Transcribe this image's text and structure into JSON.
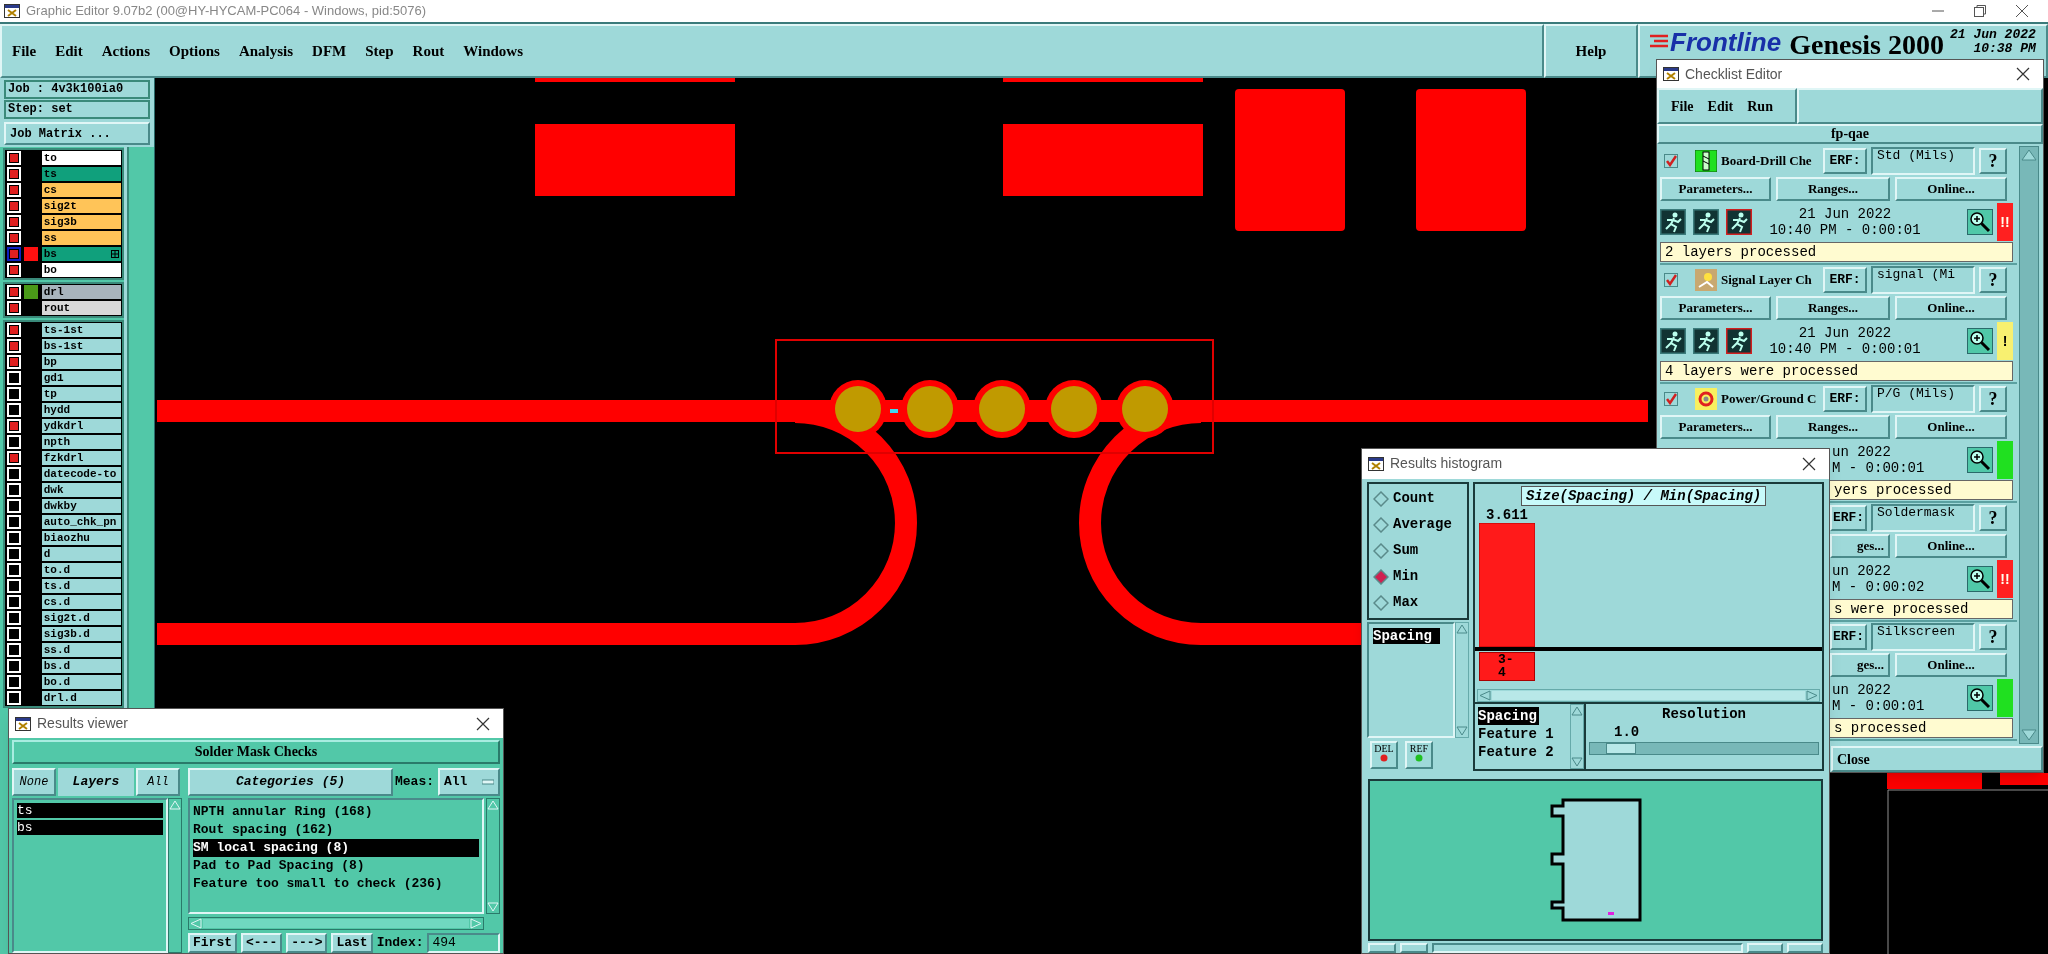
{
  "window": {
    "title": "Graphic Editor 9.07b2 (00@HY-HYCAM-PC064 - Windows, pid:5076)"
  },
  "menu": [
    "File",
    "Edit",
    "Actions",
    "Options",
    "Analysis",
    "DFM",
    "Step",
    "Rout",
    "Windows"
  ],
  "help": "Help",
  "brand": {
    "logo": "Frontline",
    "product": "Genesis 2000",
    "date": "21 Jun 2022",
    "time": "10:38 PM"
  },
  "job_panel": {
    "job": "Job : 4v3k100ia0",
    "step": "Step: set",
    "matrix_button": "Job Matrix ...",
    "layer_groups": [
      [
        {
          "name": "to",
          "checked": true,
          "selected": false,
          "color": "#ffffff"
        },
        {
          "name": "ts",
          "checked": true,
          "selected": false,
          "color": "#10a07c"
        },
        {
          "name": "cs",
          "checked": true,
          "selected": false,
          "color": "#ffc458"
        },
        {
          "name": "sig2t",
          "checked": true,
          "selected": false,
          "color": "#ffc458"
        },
        {
          "name": "sig3b",
          "checked": true,
          "selected": false,
          "color": "#ffc458"
        },
        {
          "name": "ss",
          "checked": true,
          "selected": false,
          "color": "#ffc458"
        },
        {
          "name": "bs",
          "checked": true,
          "selected": true,
          "color": "#10a07c",
          "swatch": {
            "color": "#ff1010"
          }
        },
        {
          "name": "bo",
          "checked": true,
          "selected": false,
          "color": "#ffffff"
        }
      ],
      [
        {
          "name": "drl",
          "checked": true,
          "selected": false,
          "color": "#a8b4bc",
          "swatch": {
            "color": "#4a9a18"
          }
        },
        {
          "name": "rout",
          "checked": true,
          "selected": false,
          "color": "#d8d8d8"
        }
      ],
      [
        {
          "name": "ts-1st",
          "checked": true,
          "selected": false,
          "color": "#9ed9d9"
        },
        {
          "name": "bs-1st",
          "checked": true,
          "selected": false,
          "color": "#9ed9d9"
        },
        {
          "name": "bp",
          "checked": true,
          "selected": false,
          "color": "#9ed9d9"
        },
        {
          "name": "gd1",
          "checked": false,
          "selected": false,
          "color": "#9ed9d9"
        },
        {
          "name": "tp",
          "checked": false,
          "selected": false,
          "color": "#9ed9d9"
        },
        {
          "name": "hydd",
          "checked": false,
          "selected": false,
          "color": "#9ed9d9"
        },
        {
          "name": "ydkdrl",
          "checked": true,
          "selected": false,
          "color": "#9ed9d9"
        },
        {
          "name": "npth",
          "checked": false,
          "selected": false,
          "color": "#9ed9d9"
        },
        {
          "name": "fzkdrl",
          "checked": true,
          "selected": false,
          "color": "#9ed9d9"
        },
        {
          "name": "datecode-to",
          "checked": false,
          "selected": false,
          "color": "#9ed9d9"
        },
        {
          "name": "dwk",
          "checked": false,
          "selected": false,
          "color": "#9ed9d9"
        },
        {
          "name": "dwkby",
          "checked": false,
          "selected": false,
          "color": "#9ed9d9"
        },
        {
          "name": "auto_chk_pn",
          "checked": false,
          "selected": false,
          "color": "#9ed9d9"
        },
        {
          "name": "biaozhu",
          "checked": false,
          "selected": false,
          "color": "#9ed9d9"
        },
        {
          "name": "d",
          "checked": false,
          "selected": false,
          "color": "#9ed9d9"
        },
        {
          "name": "to.d",
          "checked": false,
          "selected": false,
          "color": "#9ed9d9"
        },
        {
          "name": "ts.d",
          "checked": false,
          "selected": false,
          "color": "#9ed9d9"
        },
        {
          "name": "cs.d",
          "checked": false,
          "selected": false,
          "color": "#9ed9d9"
        },
        {
          "name": "sig2t.d",
          "checked": false,
          "selected": false,
          "color": "#9ed9d9"
        },
        {
          "name": "sig3b.d",
          "checked": false,
          "selected": false,
          "color": "#9ed9d9"
        },
        {
          "name": "ss.d",
          "checked": false,
          "selected": false,
          "color": "#9ed9d9"
        },
        {
          "name": "bs.d",
          "checked": false,
          "selected": false,
          "color": "#9ed9d9"
        },
        {
          "name": "bo.d",
          "checked": false,
          "selected": false,
          "color": "#9ed9d9"
        },
        {
          "name": "drl.d",
          "checked": false,
          "selected": false,
          "color": "#9ed9d9"
        }
      ]
    ]
  },
  "checklist": {
    "title": "Checklist Editor",
    "menu": [
      "File",
      "Edit",
      "Run"
    ],
    "name": "fp-qae",
    "close": "Close",
    "entries": [
      {
        "covered_top": false,
        "covered_bottom": false,
        "checked": true,
        "kind": "drill",
        "name": "Board-Drill Che",
        "erf_label": "ERF:",
        "erf": "Std (Mils)",
        "help": "?",
        "params": "Parameters...",
        "ranges": "Ranges...",
        "online": "Online...",
        "date": "21 Jun 2022",
        "time": "10:40 PM - 0:00:01",
        "indicator": {
          "kind": "error",
          "label": "!!"
        },
        "message": "2 layers processed"
      },
      {
        "covered_top": false,
        "covered_bottom": false,
        "checked": true,
        "kind": "signal",
        "name": "Signal Layer Ch",
        "erf_label": "ERF:",
        "erf": "signal (Mi",
        "help": "?",
        "params": "Parameters...",
        "ranges": "Ranges...",
        "online": "Online...",
        "date": "21 Jun 2022",
        "time": "10:40 PM - 0:00:01",
        "indicator": {
          "kind": "warning",
          "label": "!"
        },
        "message": "4 layers were processed"
      },
      {
        "covered_top": false,
        "covered_bottom": true,
        "checked": true,
        "kind": "power",
        "name": "Power/Ground C",
        "erf_label": "ERF:",
        "erf": "P/G (Mils)",
        "help": "?",
        "params": "Parameters...",
        "ranges": "Ranges...",
        "online": "Online...",
        "date": "un 2022",
        "time": "M - 0:00:01",
        "indicator": {
          "kind": "ok"
        },
        "message": "yers processed"
      },
      {
        "covered_top": true,
        "covered_bottom": true,
        "erf_label": "ERF:",
        "erf": "Soldermask",
        "help": "?",
        "ranges": "ges...",
        "online": "Online...",
        "date": "un 2022",
        "time": "M - 0:00:02",
        "indicator": {
          "kind": "error",
          "label": "!!"
        },
        "message": "s were processed"
      },
      {
        "covered_top": true,
        "covered_bottom": true,
        "erf_label": "ERF:",
        "erf": "Silkscreen",
        "help": "?",
        "ranges": "ges...",
        "online": "Online...",
        "date": "un 2022",
        "time": "M - 0:00:01",
        "indicator": {
          "kind": "ok"
        },
        "message": "s processed"
      }
    ]
  },
  "results_histogram": {
    "title": "Results histogram",
    "modes": [
      {
        "label": "Count",
        "selected": false
      },
      {
        "label": "Average",
        "selected": false
      },
      {
        "label": "Sum",
        "selected": false
      },
      {
        "label": "Min",
        "selected": true
      },
      {
        "label": "Max",
        "selected": false
      }
    ],
    "attributes": [
      {
        "label": "Spacing",
        "selected": true
      }
    ],
    "buttons": [
      "DEL",
      "REF"
    ],
    "histogram": {
      "title": "Size(Spacing) / Min(Spacing)",
      "bins": [
        {
          "value": "3.611",
          "range": "3-4",
          "level": 1
        }
      ]
    },
    "fields": [
      {
        "label": "Spacing",
        "selected": true
      },
      {
        "label": "Feature 1",
        "selected": false
      },
      {
        "label": "Feature 2",
        "selected": false
      }
    ],
    "resolution_label": "Resolution",
    "resolution_value": "1.0",
    "resolution": {
      "level": 0.07
    }
  },
  "results_viewer": {
    "title": "Results viewer",
    "header": "Solder Mask Checks",
    "layer_buttons": [
      "None",
      "Layers",
      "All"
    ],
    "layers": [
      {
        "name": "ts",
        "selected": true
      },
      {
        "name": "bs",
        "selected": true
      }
    ],
    "categories_button": "Categories (5)",
    "meas_label": "Meas:",
    "meas_value": "All",
    "categories": [
      {
        "label": "NPTH annular Ring (168)",
        "selected": false
      },
      {
        "label": "Rout spacing (162)",
        "selected": false
      },
      {
        "label": "SM local spacing (8)",
        "selected": true
      },
      {
        "label": "Pad to Pad Spacing (8)",
        "selected": false
      },
      {
        "label": "Feature too small to check (236)",
        "selected": false
      }
    ],
    "nav_buttons": [
      "First",
      "<---",
      "--->",
      "Last"
    ],
    "index_label": "Index:",
    "index_value": "494"
  }
}
